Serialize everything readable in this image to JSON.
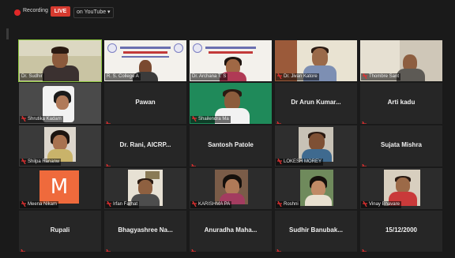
{
  "toolbar": {
    "recording_label": "Recording",
    "live_label": "LIVE",
    "stream_target": "on YouTube ▾",
    "colors": {
      "record_dot": "#e02828",
      "live_badge": "#d63a2f",
      "speaking_border": "#8cc63f",
      "muted_icon": "#e03030"
    }
  },
  "tiles": [
    {
      "name": "Dr. Sudhir",
      "type": "video",
      "speaking": true,
      "muted": false
    },
    {
      "name": "R. S. College A",
      "type": "slide",
      "muted": false
    },
    {
      "name": "Dr. Archana T. S",
      "type": "slide",
      "muted": false
    },
    {
      "name": "Dr. Jivan Katore",
      "type": "video",
      "muted": true
    },
    {
      "name": "Thombre Sant",
      "type": "video",
      "muted": true
    },
    {
      "name": "Shrutika Kadam",
      "type": "video",
      "muted": true
    },
    {
      "name": "Pawan",
      "type": "name",
      "muted": true
    },
    {
      "name": "Shailendra Ma",
      "type": "video",
      "muted": true
    },
    {
      "name": "Dr Arun Kumar...",
      "type": "name",
      "muted": true
    },
    {
      "name": "Arti kadu",
      "type": "name",
      "muted": true
    },
    {
      "name": "Shilpa Rananw",
      "type": "video",
      "muted": true
    },
    {
      "name": "Dr. Rani, AICRP...",
      "type": "name",
      "muted": true
    },
    {
      "name": "Santosh Patole",
      "type": "name",
      "muted": true
    },
    {
      "name": "LOKESH MOREY",
      "type": "video",
      "muted": true
    },
    {
      "name": "Sujata Mishra",
      "type": "name",
      "muted": true
    },
    {
      "name": "Meena Nikam",
      "type": "avatar",
      "avatar_letter": "M",
      "muted": true
    },
    {
      "name": "Irfan Farhat",
      "type": "video",
      "muted": true
    },
    {
      "name": "KARISHMA PA",
      "type": "video",
      "muted": true
    },
    {
      "name": "Roshni",
      "type": "video",
      "muted": true
    },
    {
      "name": "Vinay Bhavare",
      "type": "video",
      "muted": true
    },
    {
      "name": "Rupali",
      "type": "name",
      "muted": true
    },
    {
      "name": "Bhagyashree Na...",
      "type": "name",
      "muted": true
    },
    {
      "name": "Anuradha Maha...",
      "type": "name",
      "muted": true
    },
    {
      "name": "Sudhir Banubak...",
      "type": "name",
      "muted": true
    },
    {
      "name": "15/12/2000",
      "type": "name",
      "muted": true
    }
  ]
}
